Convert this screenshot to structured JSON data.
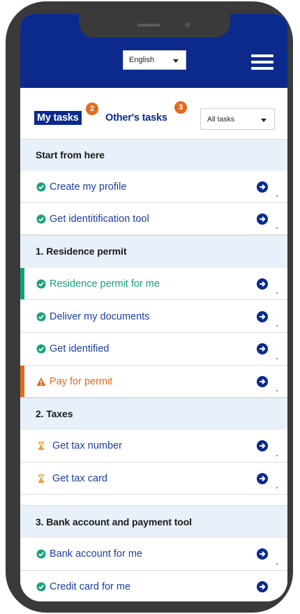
{
  "header": {
    "language": "English",
    "menu_icon": "hamburger-icon",
    "background_color": "#0b2a8c"
  },
  "tabs": {
    "mine_label": "My tasks",
    "mine_count": "2",
    "other_label": "Other's tasks",
    "other_count": "3",
    "filter_value": "All tasks",
    "badge_color": "#e36a1d"
  },
  "sections": {
    "start": "Start from here",
    "residence": "1. Residence permit",
    "taxes": "2. Taxes",
    "bank": "3. Bank account and payment tool"
  },
  "tasks": {
    "create_profile": "Create my profile",
    "identification_tool": "Get identitification tool",
    "residence_permit": "Residence permit for me",
    "deliver_documents": "Deliver my documents",
    "get_identified": "Get identified",
    "pay_permit": "Pay for permit",
    "tax_number": "Get tax number",
    "tax_card": "Get tax card",
    "bank_account": "Bank account for me",
    "credit_card": "Credit card for me"
  },
  "colors": {
    "done": "#1aa37a",
    "warning": "#e36a1d",
    "pending": "#f0a03a",
    "active": "#15a07c",
    "link": "#1c3f9e"
  },
  "icons": {
    "done": "check-circle-icon",
    "warning": "warning-icon",
    "pending": "hourglass-icon",
    "go": "arrow-circle-right-icon"
  }
}
